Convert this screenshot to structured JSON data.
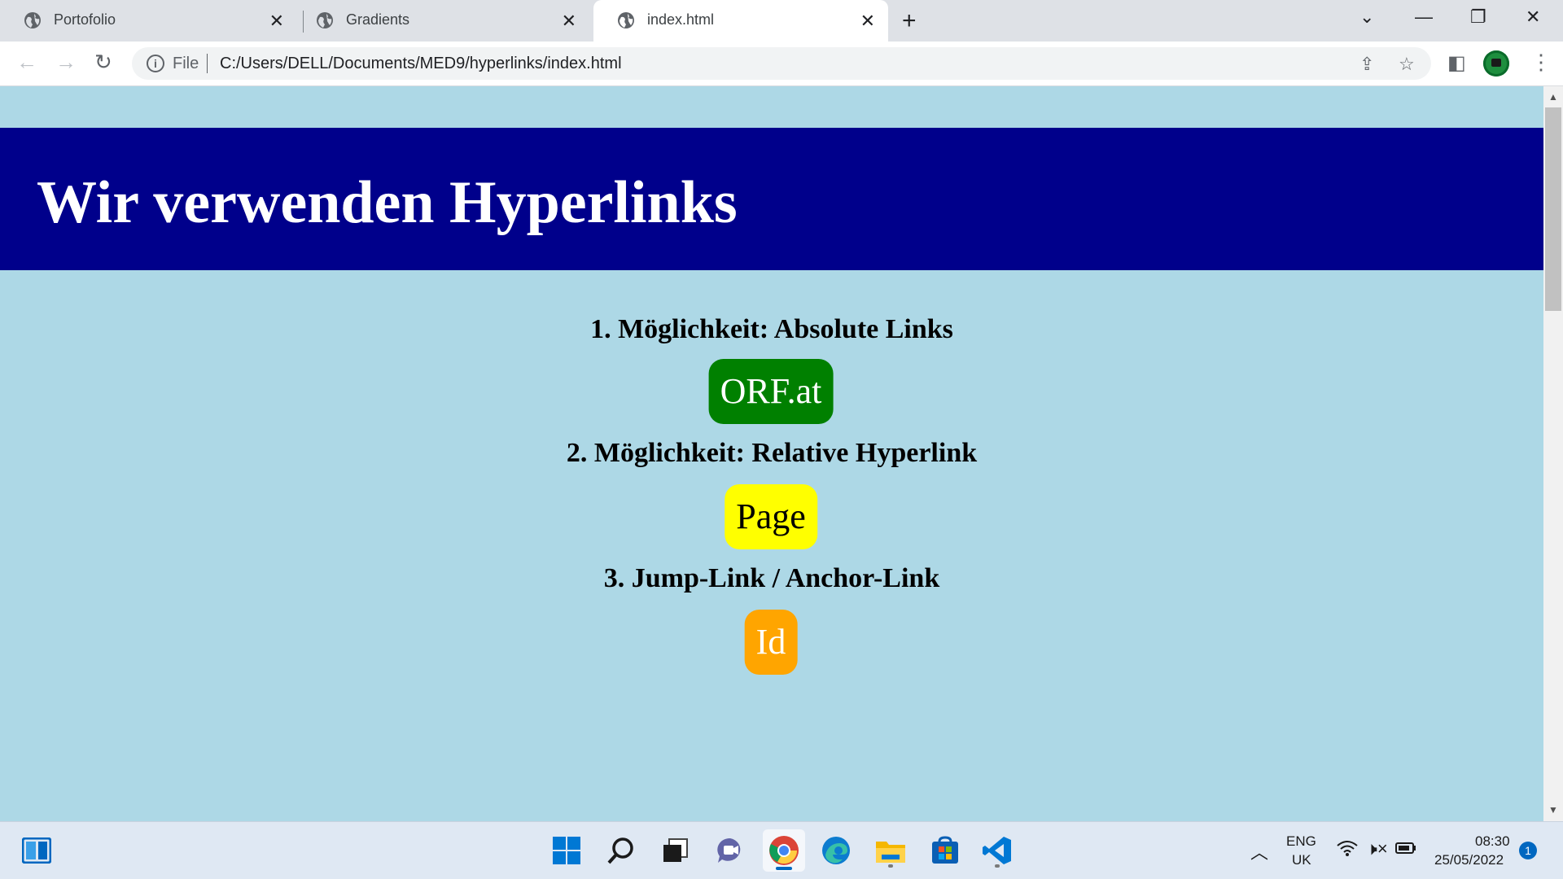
{
  "browser": {
    "tabs": [
      {
        "label": "Portofolio",
        "active": false
      },
      {
        "label": "Gradients",
        "active": false
      },
      {
        "label": "index.html",
        "active": true
      }
    ],
    "scheme_label": "File",
    "url": "C:/Users/DELL/Documents/MED9/hyperlinks/index.html"
  },
  "page": {
    "title": "Wir verwenden Hyperlinks",
    "sections": [
      {
        "heading": "1. Möglichkeit: Absolute Links",
        "link_label": "ORF.at",
        "link_bg": "#008000",
        "link_color": "#ffffff"
      },
      {
        "heading": "2. Möglichkeit: Relative Hyperlink",
        "link_label": "Page",
        "link_bg": "#ffff00",
        "link_color": "#000000"
      },
      {
        "heading": "3. Jump-Link / Anchor-Link",
        "link_label": "Id",
        "link_bg": "#ffa500",
        "link_color": "#ffffff"
      }
    ],
    "colors": {
      "background": "#add8e6",
      "header": "#00008b"
    }
  },
  "taskbar": {
    "language": "ENG",
    "region": "UK",
    "time": "08:30",
    "date": "25/05/2022",
    "notification_count": "1"
  }
}
